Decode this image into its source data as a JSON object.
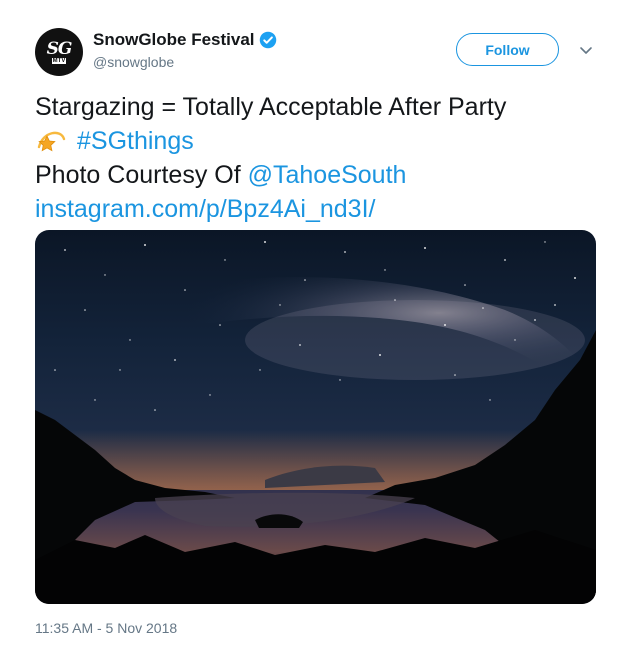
{
  "author": {
    "name": "SnowGlobe Festival",
    "handle": "@snowglobe",
    "avatar_text": "SG",
    "avatar_badge": "MTV"
  },
  "follow_label": "Follow",
  "tweet": {
    "line1": "Stargazing = Totally Acceptable After Party",
    "hashtag": "#SGthings",
    "credit_prefix": "Photo Courtesy Of ",
    "mention": "@TahoeSouth",
    "url": "instagram.com/p/Bpz4Ai_nd3I/"
  },
  "timestamp": "11:35 AM - 5 Nov 2018",
  "colors": {
    "link": "#1b95e0",
    "verified": "#1da1f2",
    "secondary_text": "#657786"
  },
  "icons": {
    "verified": "verified-badge-icon",
    "caret": "chevron-down-icon",
    "emoji": "dizzy-star-emoji"
  }
}
